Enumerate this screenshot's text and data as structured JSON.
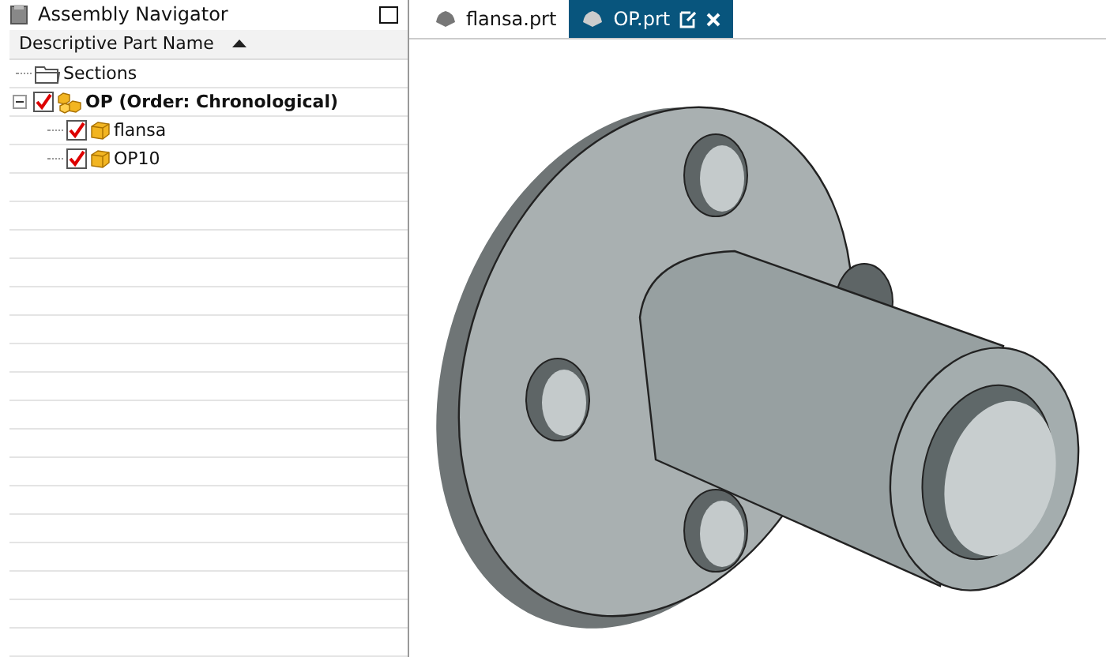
{
  "navigator": {
    "title": "Assembly Navigator",
    "column": "Descriptive Part Name",
    "sort_ascending": true,
    "tree": [
      {
        "kind": "folder",
        "label": "Sections"
      },
      {
        "kind": "assembly",
        "label": "OP (Order: Chronological)",
        "checked": true,
        "expanded": true,
        "children": [
          {
            "kind": "part",
            "label": "flansa",
            "checked": true
          },
          {
            "kind": "part",
            "label": "OP10",
            "checked": true
          }
        ]
      }
    ]
  },
  "tabs": [
    {
      "label": "flansa.prt",
      "selected": false
    },
    {
      "label": "OP.prt",
      "selected": true
    }
  ]
}
